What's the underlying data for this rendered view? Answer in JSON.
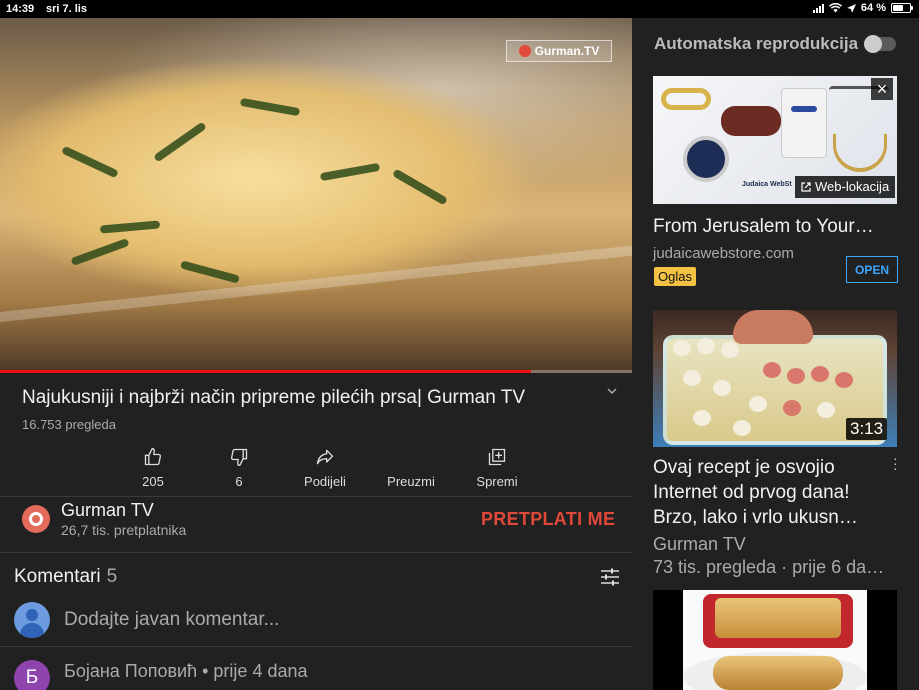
{
  "status": {
    "time": "14:39",
    "date": "sri 7. lis",
    "battery": "64 %",
    "battery_level": 0.64
  },
  "player": {
    "watermark": "Gurman.TV",
    "progress": 0.84
  },
  "video": {
    "title": "Najukusniji i najbrži način pripreme pilećih prsa| Gurman TV",
    "views": "16.753 pregleda",
    "actions": [
      {
        "icon": "thumb-up-icon",
        "label": "205"
      },
      {
        "icon": "thumb-down-icon",
        "label": "6"
      },
      {
        "icon": "share-icon",
        "label": "Podijeli"
      },
      {
        "icon": "download-icon",
        "label": "Preuzmi"
      },
      {
        "icon": "save-icon",
        "label": "Spremi"
      }
    ]
  },
  "channel": {
    "name": "Gurman TV",
    "subscribers": "26,7 tis. pretplatnika",
    "subscribe_label": "PRETPLATI ME"
  },
  "comments": {
    "heading": "Komentari",
    "count": "5",
    "placeholder": "Dodajte javan komentar...",
    "first": {
      "avatar_letter": "Б",
      "author_line": "Бојана Поповић • prije 4 dana"
    }
  },
  "sidebar": {
    "autoplay_label": "Automatska reprodukcija",
    "autoplay_on": false,
    "ad": {
      "link_label": "Web-lokacija",
      "brand_text": "Judaica WebSt",
      "title": "From Jerusalem to Your…",
      "domain": "judaicawebstore.com",
      "badge": "Oglas",
      "open_label": "OPEN"
    },
    "videos": [
      {
        "duration": "3:13",
        "title": "Ovaj recept je osvojio Internet od prvog dana! Brzo, lako i vrlo ukusn…",
        "channel": "Gurman TV",
        "meta": "73 tis. pregleda · prije 6 da…"
      }
    ]
  },
  "colors": {
    "background": "#212121",
    "subscribe": "#e0483a",
    "open": "#3ea6ff",
    "ad_badge": "#f4c242",
    "progress": "#ee1111"
  }
}
